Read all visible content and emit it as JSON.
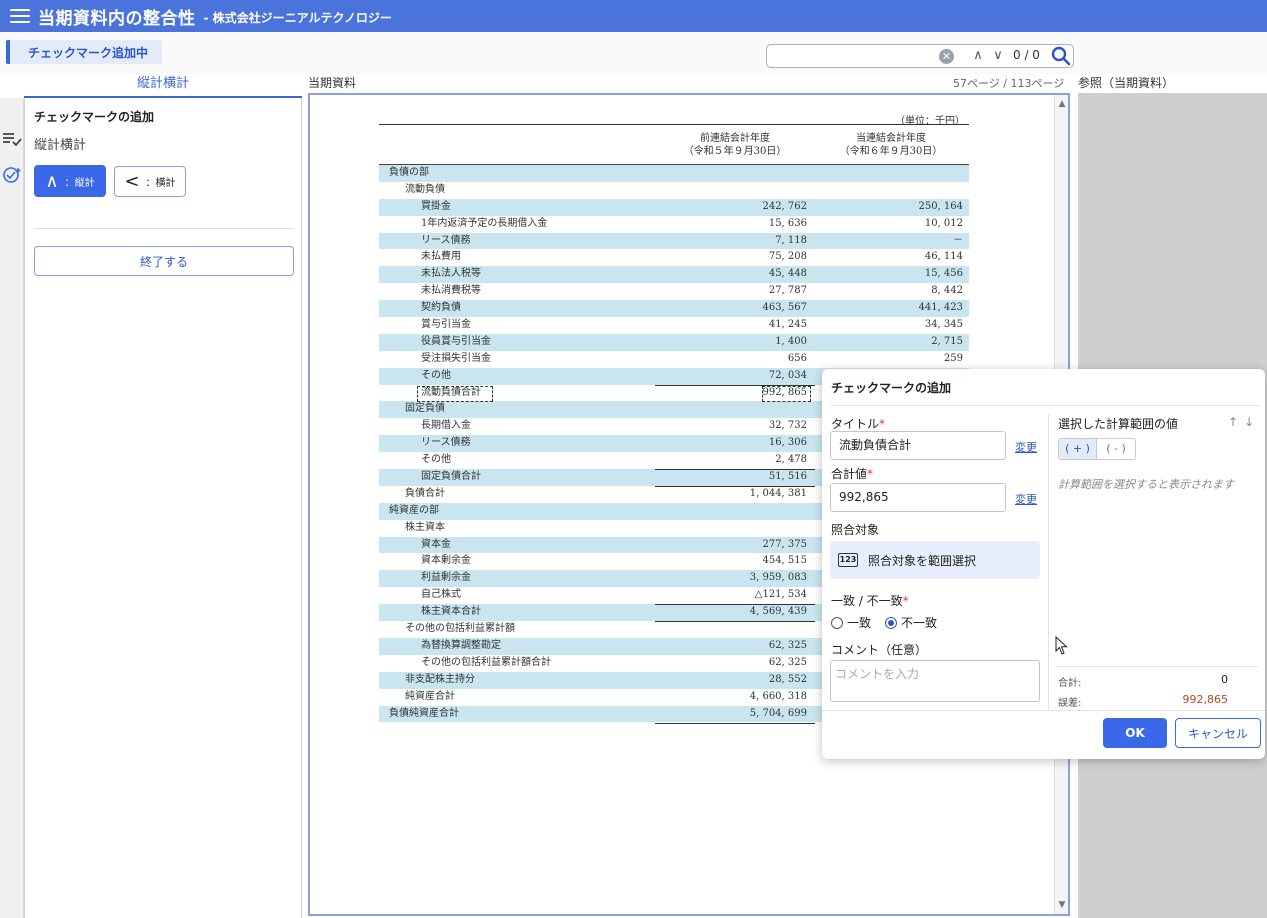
{
  "header": {
    "title": "当期資料内の整合性",
    "company": "- 株式会社ジーニアルテクノロジー"
  },
  "subheader": {
    "mode_chip": "チェックマーク追加中",
    "search": {
      "value": "",
      "hit_count": "0 / 0"
    }
  },
  "left": {
    "tab": "縦計横計",
    "panel_title": "チェックマークの追加",
    "panel_sub": "縦計横計",
    "btn_vertical": {
      "symbol": "∧",
      "label": "：縦計"
    },
    "btn_horizontal": {
      "symbol": "<",
      "label": "：横計"
    },
    "btn_end": "終了する"
  },
  "doc": {
    "label": "当期資料",
    "page": "57ページ / 113ページ",
    "ref_label": "参照（当期資料）",
    "unit": "（単位：千円）",
    "col1": [
      "前連結会計年度",
      "（令和５年９月30日）"
    ],
    "col2": [
      "当連結会計年度",
      "（令和６年９月30日）"
    ],
    "rows": [
      {
        "label": "負債の部",
        "indent": 0,
        "v1": "",
        "v2": ""
      },
      {
        "label": "流動負債",
        "indent": 1,
        "v1": "",
        "v2": ""
      },
      {
        "label": "買掛金",
        "indent": 2,
        "v1": "242, 762",
        "v2": "250, 164"
      },
      {
        "label": "1年内返済予定の長期借入金",
        "indent": 2,
        "v1": "15, 636",
        "v2": "10, 012"
      },
      {
        "label": "リース債務",
        "indent": 2,
        "v1": "7, 118",
        "v2": "－"
      },
      {
        "label": "未払費用",
        "indent": 2,
        "v1": "75, 208",
        "v2": "46, 114"
      },
      {
        "label": "未払法人税等",
        "indent": 2,
        "v1": "45, 448",
        "v2": "15, 456"
      },
      {
        "label": "未払消費税等",
        "indent": 2,
        "v1": "27, 787",
        "v2": "8, 442"
      },
      {
        "label": "契約負債",
        "indent": 2,
        "v1": "463, 567",
        "v2": "441, 423"
      },
      {
        "label": "賞与引当金",
        "indent": 2,
        "v1": "41, 245",
        "v2": "34, 345"
      },
      {
        "label": "役員賞与引当金",
        "indent": 2,
        "v1": "1, 400",
        "v2": "2, 715"
      },
      {
        "label": "受注損失引当金",
        "indent": 2,
        "v1": "656",
        "v2": "259"
      },
      {
        "label": "その他",
        "indent": 2,
        "v1": "72, 034",
        "v2": ""
      },
      {
        "label": "流動負債合計",
        "indent": 2,
        "v1": "992, 865",
        "v2": ""
      },
      {
        "label": "固定負債",
        "indent": 1,
        "v1": "",
        "v2": ""
      },
      {
        "label": "長期借入金",
        "indent": 2,
        "v1": "32, 732",
        "v2": ""
      },
      {
        "label": "リース債務",
        "indent": 2,
        "v1": "16, 306",
        "v2": ""
      },
      {
        "label": "その他",
        "indent": 2,
        "v1": "2, 478",
        "v2": ""
      },
      {
        "label": "固定負債合計",
        "indent": 2,
        "v1": "51, 516",
        "v2": ""
      },
      {
        "label": "負債合計",
        "indent": 1,
        "v1": "1, 044, 381",
        "v2": ""
      },
      {
        "label": "純資産の部",
        "indent": 0,
        "v1": "",
        "v2": ""
      },
      {
        "label": "株主資本",
        "indent": 1,
        "v1": "",
        "v2": ""
      },
      {
        "label": "資本金",
        "indent": 2,
        "v1": "277, 375",
        "v2": ""
      },
      {
        "label": "資本剰余金",
        "indent": 2,
        "v1": "454, 515",
        "v2": ""
      },
      {
        "label": "利益剰余金",
        "indent": 2,
        "v1": "3, 959, 083",
        "v2": ""
      },
      {
        "label": "自己株式",
        "indent": 2,
        "v1": "△121, 534",
        "v2": ""
      },
      {
        "label": "株主資本合計",
        "indent": 2,
        "v1": "4, 569, 439",
        "v2": ""
      },
      {
        "label": "その他の包括利益累計額",
        "indent": 1,
        "v1": "",
        "v2": ""
      },
      {
        "label": "為替換算調整勘定",
        "indent": 2,
        "v1": "62, 325",
        "v2": ""
      },
      {
        "label": "その他の包括利益累計額合計",
        "indent": 2,
        "v1": "62, 325",
        "v2": ""
      },
      {
        "label": "非支配株主持分",
        "indent": 1,
        "v1": "28, 552",
        "v2": ""
      },
      {
        "label": "純資産合計",
        "indent": 1,
        "v1": "4, 660, 318",
        "v2": ""
      },
      {
        "label": "負債純資産合計",
        "indent": 0,
        "v1": "5, 704, 699",
        "v2": ""
      }
    ]
  },
  "dialog": {
    "title": "チェックマークの追加",
    "title_label": "タイトル",
    "title_value": "流動負債合計",
    "total_label": "合計値",
    "total_value": "992,865",
    "change_link": "変更",
    "target_label": "照合対象",
    "target_btn": "照合対象を範囲選択",
    "match_label": "一致 / 不一致",
    "match_opt": "一致",
    "mismatch_opt": "不一致",
    "comment_label": "コメント（任意）",
    "comment_placeholder": "コメントを入力",
    "range_title": "選択した計算範囲の値",
    "seg_plus": "( + )",
    "seg_minus": "( - )",
    "range_hint": "計算範囲を選択すると表示されます",
    "sum_label": "合計:",
    "sum_value": "0",
    "err_label": "誤差:",
    "err_value": "992,865",
    "ok": "OK",
    "cancel": "キャンセル"
  },
  "colors": {
    "accent": "#3b68e8",
    "header": "#4a73dc",
    "row_shade": "#c9e6f0"
  }
}
